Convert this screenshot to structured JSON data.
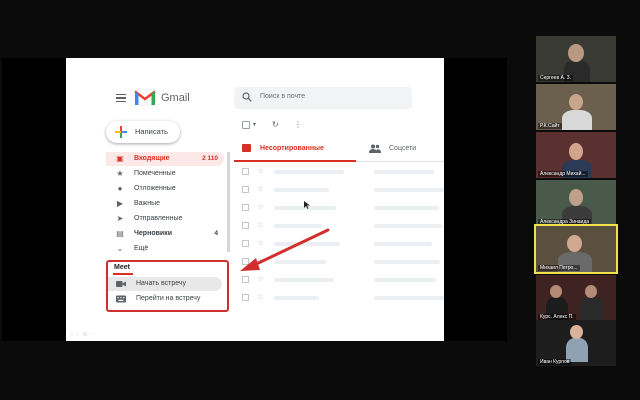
{
  "app": {
    "name": "Gmail",
    "search_placeholder": "Поиск в почте",
    "compose_label": "Написать"
  },
  "sidebar": {
    "items": [
      {
        "label": "Входящие",
        "count": "2 110",
        "icon": "inbox-icon",
        "active": true
      },
      {
        "label": "Помеченные",
        "count": "",
        "icon": "star-icon"
      },
      {
        "label": "Отложенные",
        "count": "",
        "icon": "clock-icon"
      },
      {
        "label": "Важные",
        "count": "",
        "icon": "label-important-icon"
      },
      {
        "label": "Отправленные",
        "count": "",
        "icon": "send-icon"
      },
      {
        "label": "Черновики",
        "count": "4",
        "icon": "draft-icon",
        "bold": true
      },
      {
        "label": "Ещё",
        "count": "",
        "icon": "chevron-down-icon"
      }
    ]
  },
  "meet": {
    "heading": "Meet",
    "start_label": "Начать встречу",
    "join_label": "Перейти на встречу"
  },
  "toolbar": {
    "refresh_glyph": "↻",
    "more_glyph": "⋮"
  },
  "tabs": [
    {
      "label": "Несортированные",
      "active": true
    },
    {
      "label": "Соцсети",
      "active": false
    }
  ],
  "participants": [
    {
      "name": "Сергеев А. З."
    },
    {
      "name": "Р.К.Сайт"
    },
    {
      "name": "Александр Михай..."
    },
    {
      "name": "Александра Зинаида"
    },
    {
      "name": "Михаил Петро...",
      "active": true
    },
    {
      "name": "Курс. Алекс П."
    },
    {
      "name": "Иван Курпов"
    }
  ],
  "colors": {
    "accent": "#d93025",
    "highlight_box": "#d22e2e",
    "active_speaker": "#f2e14a"
  }
}
